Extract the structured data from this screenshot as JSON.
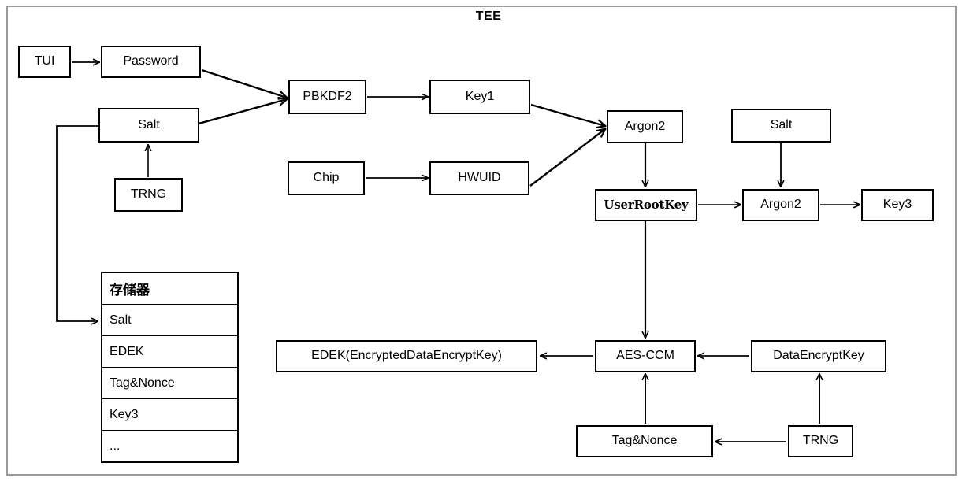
{
  "diagram": {
    "frame_label": "TEE",
    "frame_color": "#9a9a9a",
    "line_color": "#000000",
    "background": "#ffffff"
  },
  "nodes": {
    "tui": "TUI",
    "password": "Password",
    "salt_left": "Salt",
    "trng_left": "TRNG",
    "pbkdf2": "PBKDF2",
    "key1": "Key1",
    "chip": "Chip",
    "hwuid": "HWUID",
    "argon2_top": "Argon2",
    "salt_right": "Salt",
    "user_root_key": "UserRootKey",
    "argon2_second": "Argon2",
    "key3": "Key3",
    "edek": "EDEK(EncryptedDataEncryptKey)",
    "aes_ccm": "AES-CCM",
    "data_encrypt_key": "DataEncryptKey",
    "tag_nonce_bottom": "Tag&Nonce",
    "trng_bottom": "TRNG"
  },
  "storage": {
    "header": "存储器",
    "rows": [
      "Salt",
      "EDEK",
      "Tag&Nonce",
      "Key3",
      "..."
    ]
  }
}
